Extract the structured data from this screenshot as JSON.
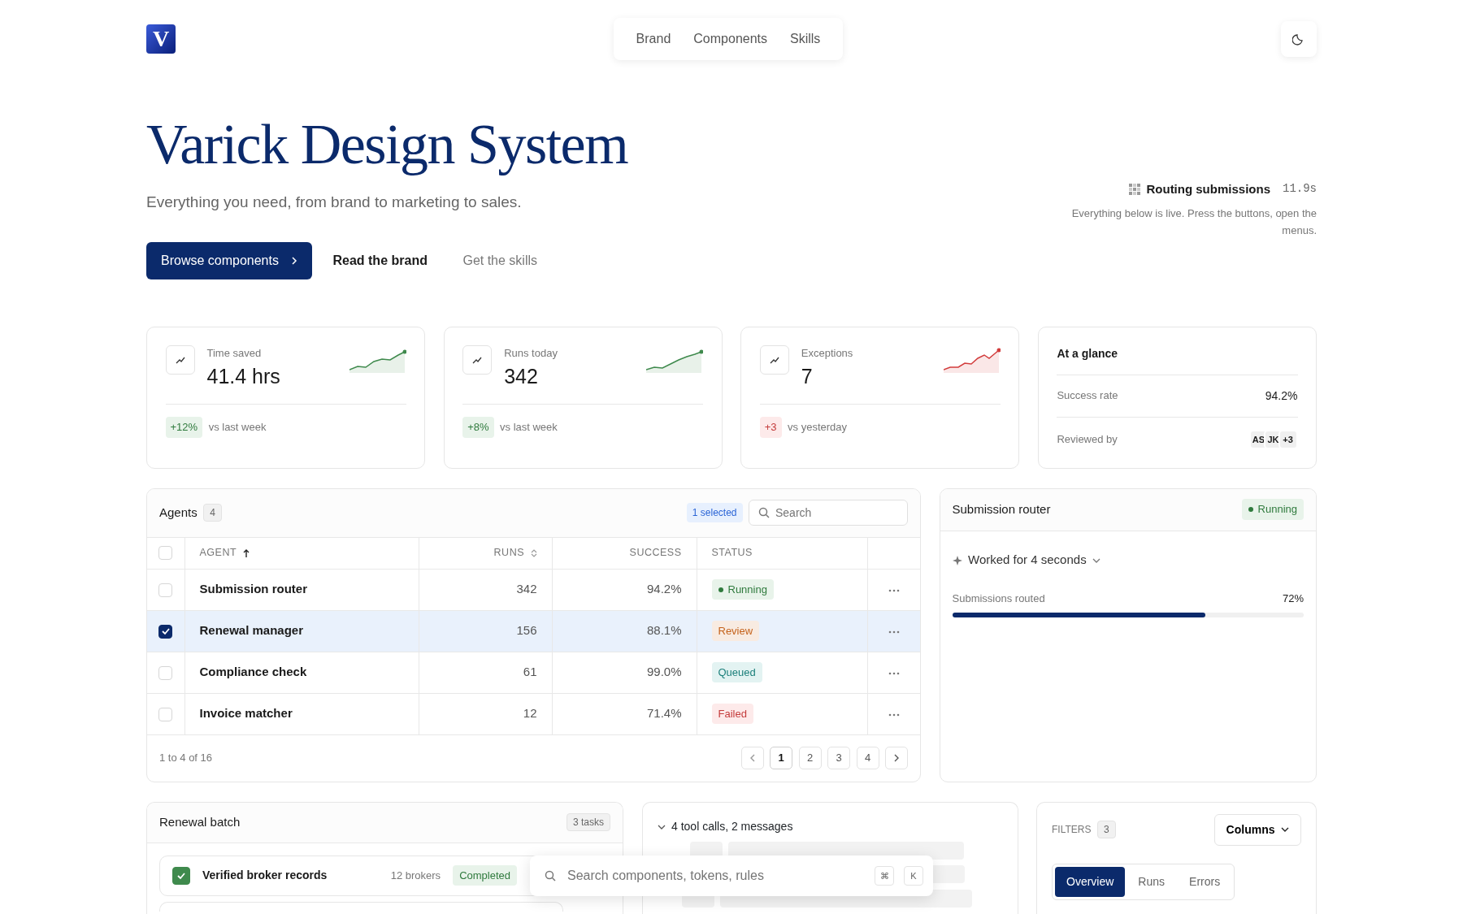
{
  "logo": {
    "letter": "V"
  },
  "nav": [
    "Brand",
    "Components",
    "Skills"
  ],
  "hero": {
    "title": "Varick Design System",
    "subtitle": "Everything you need, from brand to marketing to sales.",
    "buttons": [
      {
        "label": "Browse components",
        "kind": "primary"
      },
      {
        "label": "Read the brand",
        "kind": "secondary"
      },
      {
        "label": "Get the skills",
        "kind": "muted"
      }
    ]
  },
  "live": {
    "label": "Routing submissions",
    "time": "11.9s",
    "note": "Everything below is live. Press the buttons, open the menus."
  },
  "stats": [
    {
      "label": "Time saved",
      "value": "41.4 hrs",
      "delta": "+12%",
      "kind": "positive",
      "compare": "vs last week"
    },
    {
      "label": "Runs today",
      "value": "342",
      "delta": "+8%",
      "kind": "positive",
      "compare": "vs last week"
    },
    {
      "label": "Exceptions",
      "value": "7",
      "delta": "+3",
      "kind": "negative",
      "compare": "vs yesterday"
    }
  ],
  "glance": {
    "title": "At a glance",
    "success_label": "Success rate",
    "success_value": "94.2%",
    "reviewed_label": "Reviewed by",
    "avatars": [
      "AS",
      "JK",
      "+3"
    ]
  },
  "agents": {
    "title": "Agents",
    "count": "4",
    "selected_note": "1 selected",
    "search": {
      "placeholder": "Search"
    },
    "header_checked": false,
    "columns": [
      {
        "label": "AGENT",
        "sorted": true
      },
      {
        "label": "RUNS",
        "sorted": false
      },
      {
        "label": "SUCCESS"
      },
      {
        "label": "STATUS"
      }
    ],
    "rows": [
      {
        "checked": false,
        "name": "Submission router",
        "runs": "342",
        "success": "94.2%",
        "status": {
          "label": "Running",
          "kind": "running"
        }
      },
      {
        "checked": true,
        "name": "Renewal manager",
        "runs": "156",
        "success": "88.1%",
        "status": {
          "label": "Review",
          "kind": "review"
        }
      },
      {
        "checked": false,
        "name": "Compliance check",
        "runs": "61",
        "success": "99.0%",
        "status": {
          "label": "Queued",
          "kind": "queued"
        }
      },
      {
        "checked": false,
        "name": "Invoice matcher",
        "runs": "12",
        "success": "71.4%",
        "status": {
          "label": "Failed",
          "kind": "failed"
        }
      }
    ],
    "footer": "1 to 4 of 16",
    "pages": [
      {
        "label": "1",
        "selected": true
      },
      {
        "label": "2",
        "selected": false
      },
      {
        "label": "3",
        "selected": false
      },
      {
        "label": "4",
        "selected": false
      }
    ]
  },
  "router": {
    "title": "Submission router",
    "status": {
      "label": "Running",
      "kind": "running"
    },
    "worked": "Worked for 4 seconds",
    "progress": {
      "label": "Submissions routed",
      "reading": "72%",
      "level": 0.72
    }
  },
  "batch": {
    "title": "Renewal batch",
    "count": "3 tasks",
    "tasks": [
      {
        "checked": true,
        "name": "Verified broker records",
        "meta": "12 brokers",
        "status": {
          "label": "Completed",
          "kind": "completed"
        }
      }
    ]
  },
  "tool_calls": {
    "summary": "4 tool calls, 2 messages",
    "expanded": true
  },
  "filters": {
    "label": "FILTERS",
    "count": "3",
    "columns_button": "Columns",
    "tabs": [
      {
        "label": "Overview",
        "selected": true
      },
      {
        "label": "Runs",
        "selected": false
      },
      {
        "label": "Errors",
        "selected": false
      }
    ]
  },
  "command_palette": {
    "placeholder": "Search components, tokens, rules",
    "keys": [
      "⌘",
      "K"
    ]
  }
}
